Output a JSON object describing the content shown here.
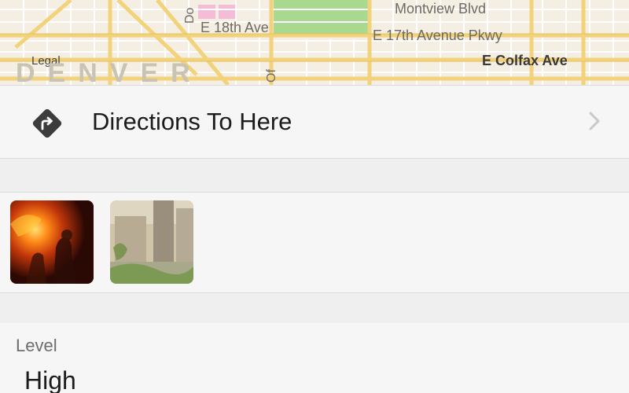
{
  "map": {
    "streets": {
      "montview": "Montview Blvd",
      "e18th": "E 18th Ave",
      "e17th_pkwy": "E 17th Avenue Pkwy",
      "colfax": "E Colfax Ave"
    },
    "vertical_labels": {
      "left": "Do",
      "right": "Of"
    },
    "legal": "Legal",
    "city": "DENVER",
    "colors": {
      "land": "#f4efe2",
      "major_road": "#f2d27a",
      "minor_road": "#ffffff",
      "park": "#a8d98f",
      "poi": "#f5bcd7"
    }
  },
  "directions": {
    "label": "Directions To Here",
    "icon": "directions-icon",
    "chevron": "chevron-right-icon"
  },
  "photos": [
    {
      "name": "fire-photo",
      "description_icon": "photo-thumbnail"
    },
    {
      "name": "street-photo",
      "description_icon": "photo-thumbnail"
    }
  ],
  "level": {
    "label": "Level",
    "value": "High"
  }
}
